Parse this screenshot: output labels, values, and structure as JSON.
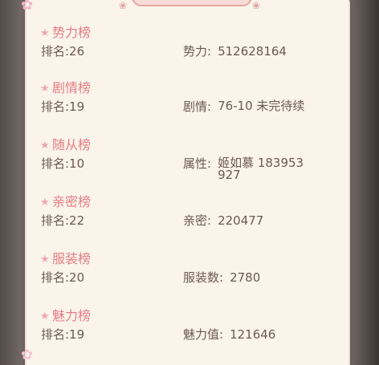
{
  "rankings": [
    {
      "title": "势力榜",
      "rank": "排名:26",
      "label": "势力:",
      "value": "512628164"
    },
    {
      "title": "剧情榜",
      "rank": "排名:19",
      "label": "剧情:",
      "value": "76-10 未完待续"
    },
    {
      "title": "随从榜",
      "rank": "排名:10",
      "label": "属性:",
      "value": "姬如慕 183953927"
    },
    {
      "title": "亲密榜",
      "rank": "排名:22",
      "label": "亲密:",
      "value": "220477"
    },
    {
      "title": "服装榜",
      "rank": "排名:20",
      "label": "服装数:",
      "value": "2780"
    },
    {
      "title": "魅力榜",
      "rank": "排名:19",
      "label": "魅力值:",
      "value": "121646"
    }
  ],
  "icons": {
    "section_marker": "star-icon",
    "decoration": "flower-icon"
  },
  "colors": {
    "title": "#e57e87",
    "text": "#6b5a54",
    "panel": "#faf4ea"
  }
}
